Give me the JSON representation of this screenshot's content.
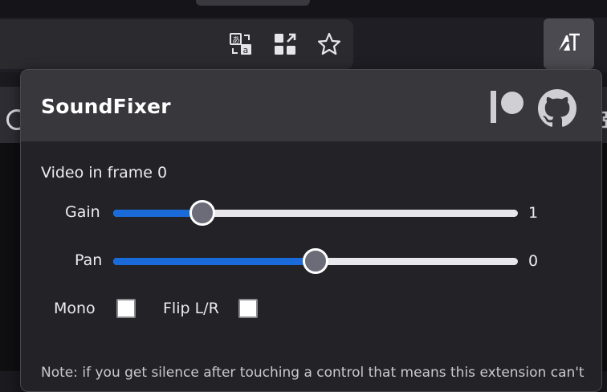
{
  "browser": {
    "icons": [
      "translate-icon",
      "grid-apps-icon",
      "star-icon",
      "soundfixer-extension-icon"
    ]
  },
  "popup": {
    "title": "SoundFixer",
    "header_icons": [
      "patreon-icon",
      "github-icon"
    ],
    "frame_label": "Video in frame 0",
    "gain": {
      "label": "Gain",
      "value": "1",
      "fraction": 0.22
    },
    "pan": {
      "label": "Pan",
      "value": "0",
      "fraction": 0.5
    },
    "mono": {
      "label": "Mono",
      "checked": false
    },
    "flip": {
      "label": "Flip L/R",
      "checked": false
    },
    "note": "Note: if you get silence after touching a control that means this extension can't"
  },
  "colors": {
    "accent": "#1a6bd9",
    "header_bg": "#38373c",
    "popup_bg": "#232227"
  }
}
